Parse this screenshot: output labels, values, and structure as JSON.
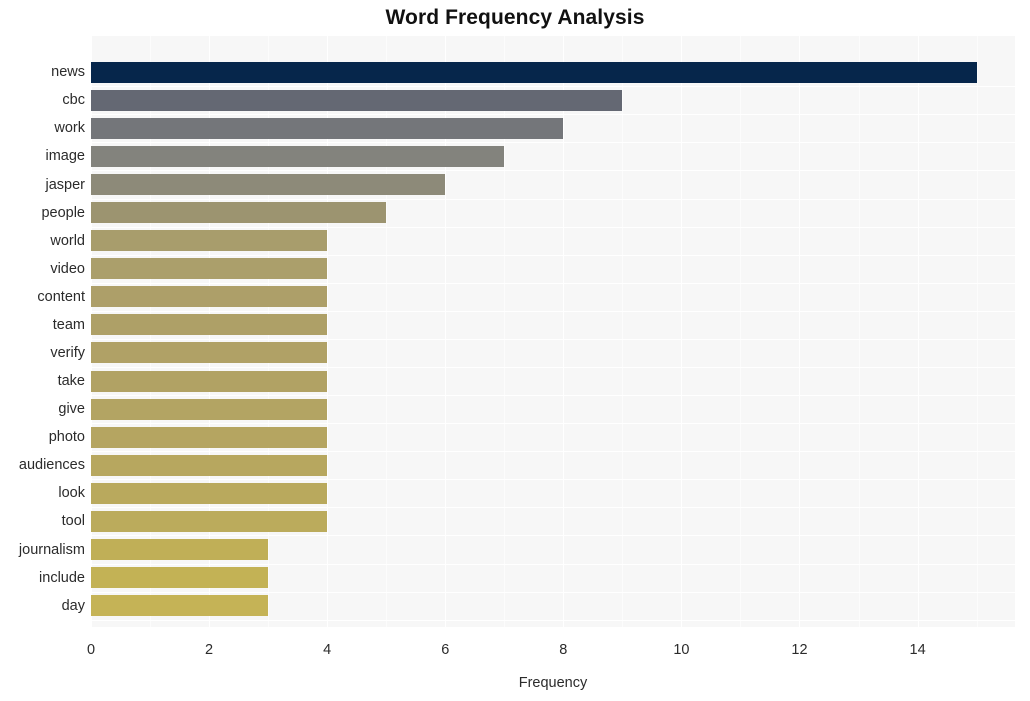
{
  "chart_data": {
    "type": "bar",
    "orientation": "horizontal",
    "title": "Word Frequency Analysis",
    "xlabel": "Frequency",
    "ylabel": "",
    "xlim": [
      0,
      15.65
    ],
    "xticks": [
      0,
      2,
      4,
      6,
      8,
      10,
      12,
      14
    ],
    "grid": true,
    "legend": false,
    "categories": [
      "news",
      "cbc",
      "work",
      "image",
      "jasper",
      "people",
      "world",
      "video",
      "content",
      "team",
      "verify",
      "take",
      "give",
      "photo",
      "audiences",
      "look",
      "tool",
      "journalism",
      "include",
      "day"
    ],
    "values": [
      15,
      9,
      8,
      7,
      6,
      5,
      4,
      4,
      4,
      4,
      4,
      4,
      4,
      4,
      4,
      4,
      4,
      3,
      3,
      3
    ],
    "bar_colors": [
      "#06264b",
      "#646873",
      "#74767a",
      "#83837d",
      "#8d8a79",
      "#9c9470",
      "#a89d6c",
      "#ab9f6b",
      "#ad9f69",
      "#aea067",
      "#b0a166",
      "#b1a264",
      "#b3a463",
      "#b5a561",
      "#b7a75f",
      "#b9a95d",
      "#bbab5c",
      "#c0af57",
      "#c3b255",
      "#c5b356"
    ]
  },
  "style": {
    "plot_background": "#f7f7f7",
    "gridline_color": "#ffffff",
    "figure_background": "#ffffff",
    "text_color": "#2b2b2b",
    "title_color": "#111111"
  }
}
